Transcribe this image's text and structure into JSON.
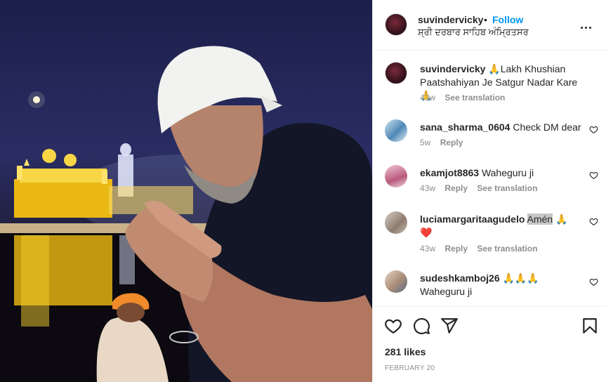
{
  "post": {
    "username": "suvindervicky",
    "separator": "•",
    "follow_label": "Follow",
    "location": "ਸ਼੍ਰੀ ਦਰਬਾਰ ਸਾਹਿਬ ਅੰਮ੍ਰਿਤਸਰ"
  },
  "comments": [
    {
      "user": "suvindervicky",
      "text": "🙏Lakh Khushian Paatshahiyan Je Satgur Nadar Kare🙏",
      "age": "43w",
      "reply": "",
      "translate": "See translation"
    },
    {
      "user": "sana_sharma_0604",
      "text": "Check DM dear",
      "age": "5w",
      "reply": "Reply",
      "translate": ""
    },
    {
      "user": "ekamjot8863",
      "text": "Waheguru ji",
      "age": "43w",
      "reply": "Reply",
      "translate": "See translation"
    },
    {
      "user": "luciamargaritaagudelo",
      "text_highlight": "Amén",
      "text_after": "🙏",
      "text_line2": "❤️",
      "age": "43w",
      "reply": "Reply",
      "translate": "See translation"
    },
    {
      "user": "sudeshkamboj26",
      "text": "🙏🙏🙏",
      "text_line2": "Waheguru ji"
    }
  ],
  "actions": {
    "likes": "281 likes",
    "date": "FEBRUARY 20"
  },
  "icons": [
    "more-options-icon",
    "heart-icon",
    "comment-icon",
    "share-icon",
    "save-icon"
  ],
  "colors": {
    "follow": "#0095f6",
    "heart_red": "#ed4956",
    "muted": "#8e8e8e"
  }
}
